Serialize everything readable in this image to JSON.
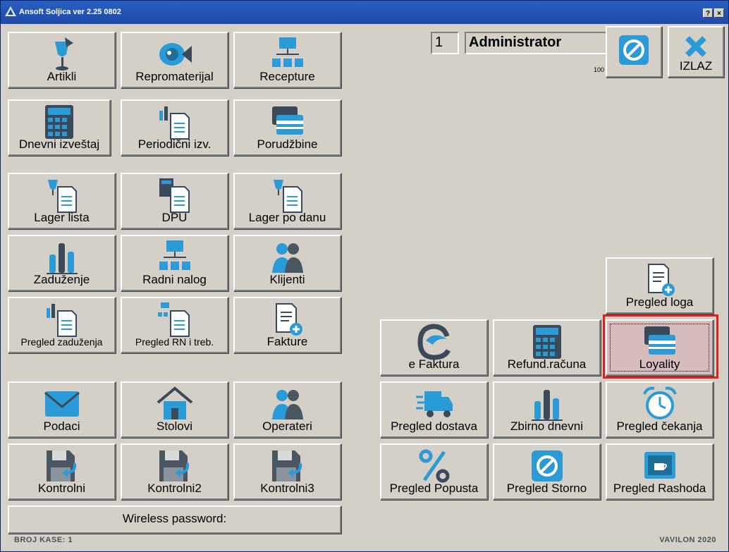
{
  "window": {
    "title": "Ansoft Soljica ver 2.25 0802",
    "help_label": "?",
    "close_label": "×"
  },
  "user": {
    "number": "1",
    "name": "Administrator",
    "small_text": "100"
  },
  "top_actions": {
    "cancel_label": "",
    "exit_label": "IZLAZ"
  },
  "left_buttons": [
    {
      "label": "Artikli",
      "icon": "wine-glass-pie-icon"
    },
    {
      "label": "Repromaterijal",
      "icon": "fish-icon"
    },
    {
      "label": "Recepture",
      "icon": "hierarchy-icon"
    },
    {
      "label": "Dnevni izveštaj",
      "icon": "calculator-icon"
    },
    {
      "label": "Periodični izv.",
      "icon": "chart-doc-icon"
    },
    {
      "label": "Porudžbine",
      "icon": "cards-icon"
    },
    {
      "label": "Lager lista",
      "icon": "glass-doc-icon"
    },
    {
      "label": "DPU",
      "icon": "calc-doc-icon"
    },
    {
      "label": "Lager po danu",
      "icon": "glass-doc-icon"
    },
    {
      "label": "Zaduženje",
      "icon": "bar-chart-icon"
    },
    {
      "label": "Radni nalog",
      "icon": "hierarchy-icon"
    },
    {
      "label": "Klijenti",
      "icon": "people-icon"
    },
    {
      "label": "Pregled zaduženja",
      "icon": "chart-doc-icon"
    },
    {
      "label": "Pregled RN i treb.",
      "icon": "hier-doc-icon"
    },
    {
      "label": "Fakture",
      "icon": "doc-plus-icon"
    },
    {
      "label": "Podaci",
      "icon": "envelope-icon"
    },
    {
      "label": "Stolovi",
      "icon": "house-icon"
    },
    {
      "label": "Operateri",
      "icon": "people-icon"
    },
    {
      "label": "Kontrolni",
      "icon": "floppy-icon"
    },
    {
      "label": "Kontrolni2",
      "icon": "floppy-icon"
    },
    {
      "label": "Kontrolni3",
      "icon": "floppy-icon"
    }
  ],
  "wireless": {
    "label": "Wireless password:"
  },
  "right_buttons": [
    {
      "label": "Pregled loga",
      "icon": "doc-plus-icon"
    },
    {
      "label": "e Faktura",
      "icon": "e-logo-icon"
    },
    {
      "label": "Refund.računa",
      "icon": "calculator-icon"
    },
    {
      "label": "Loyality",
      "icon": "cards-icon"
    },
    {
      "label": "Pregled dostava",
      "icon": "truck-icon"
    },
    {
      "label": "Zbirno dnevni",
      "icon": "bar-chart-icon"
    },
    {
      "label": "Pregled čekanja",
      "icon": "alarm-clock-icon"
    },
    {
      "label": "Pregled Popusta",
      "icon": "percent-icon"
    },
    {
      "label": "Pregled Storno",
      "icon": "cancel-circle-icon"
    },
    {
      "label": "Pregled Rashoda",
      "icon": "coffee-photo-icon"
    }
  ],
  "status": {
    "left": "BROJ KASE: 1",
    "right": "VAVILON 2020"
  },
  "colors": {
    "titlebar": "#1c4aa8",
    "face": "#d4d0c8",
    "accent_blue": "#2b9bd8",
    "selected": "#d6bcbc",
    "highlight_frame": "#e02020"
  }
}
